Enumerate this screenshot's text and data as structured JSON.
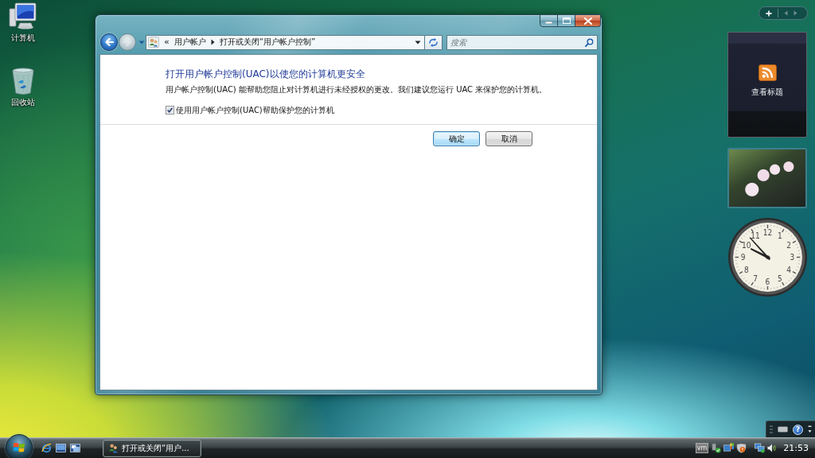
{
  "desktop_icons": [
    {
      "kind": "computer",
      "label": "计算机"
    },
    {
      "kind": "recycle-bin",
      "label": "回收站"
    }
  ],
  "window": {
    "nav_buttons": [
      {
        "kind": "back",
        "disabled": false
      },
      {
        "kind": "forward",
        "disabled": true
      }
    ],
    "address_bar": {
      "overflow": "«",
      "crumbs": [
        "用户帐户",
        "打开或关闭“用户帐户控制”"
      ]
    },
    "search": {
      "placeholder": "搜索"
    },
    "heading": "打开用户帐户控制(UAC)以使您的计算机更安全",
    "description": "用户帐户控制(UAC) 能帮助您阻止对计算机进行未经授权的更改。我们建议您运行 UAC 来保护您的计算机。",
    "checkbox": {
      "label": "使用用户帐户控制(UAC)帮助保护您的计算机",
      "checked": true
    },
    "buttons": [
      {
        "label": "确定",
        "default": true
      },
      {
        "label": "取消",
        "default": false
      }
    ]
  },
  "sidebar": {
    "gadgets": [
      {
        "kind": "feed",
        "label": "查看标题"
      },
      {
        "kind": "photo"
      },
      {
        "kind": "clock",
        "numerals": [
          "12",
          "11",
          "1",
          "10",
          "2",
          "9",
          "3",
          "8",
          "4",
          "7",
          "5",
          "6"
        ]
      }
    ]
  },
  "language_bar": {
    "help": "?"
  },
  "taskbar": {
    "tasks": [
      {
        "label": "打开或关闭“用户...",
        "selected": true
      }
    ],
    "tray": {
      "vm": "vm",
      "clock": "21:53"
    }
  }
}
